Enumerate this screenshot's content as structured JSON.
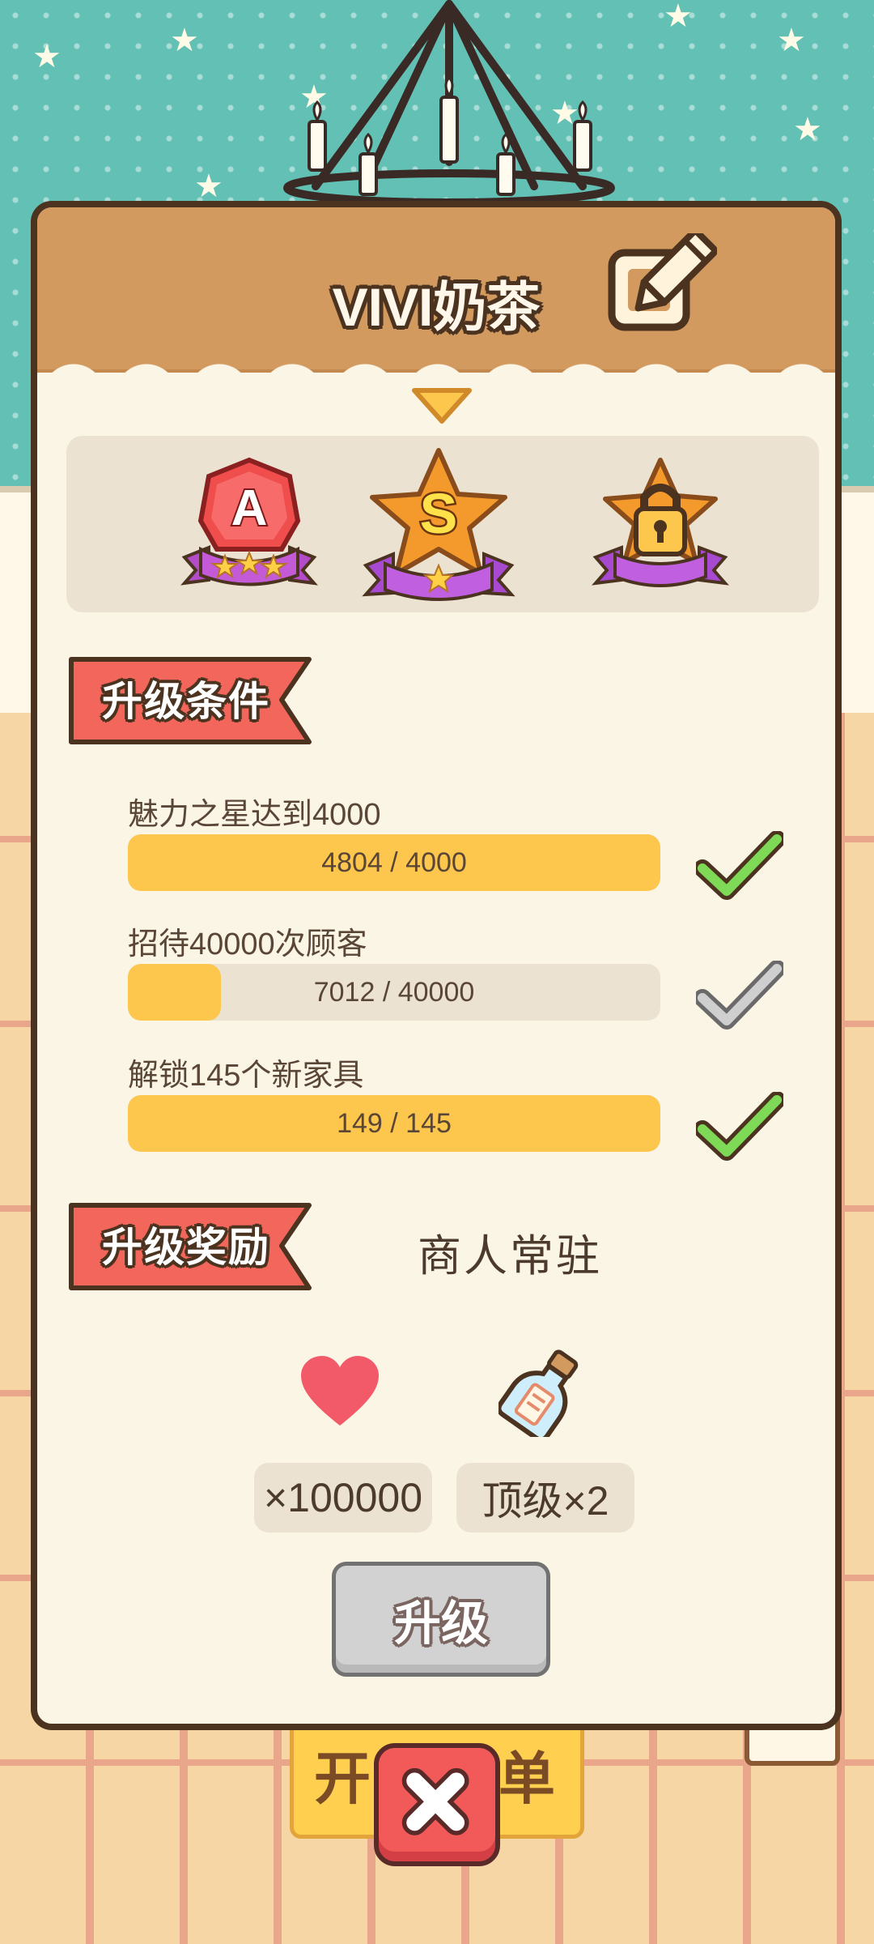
{
  "dialog": {
    "title": "VIVI奶茶",
    "edit_icon": "edit-pencil-icon"
  },
  "ranks": [
    {
      "letter": "A",
      "state": "completed",
      "stars": 3
    },
    {
      "letter": "S",
      "state": "current",
      "stars": 1
    },
    {
      "letter": "",
      "state": "locked",
      "icon": "lock-icon"
    }
  ],
  "conditions": {
    "header": "升级条件",
    "items": [
      {
        "label": "魅力之星达到4000",
        "progress_text": "4804 / 4000",
        "progress": 1.0,
        "met": true
      },
      {
        "label": "招待40000次顾客",
        "progress_text": "7012 / 40000",
        "progress": 0.1753,
        "met": false
      },
      {
        "label": "解锁145个新家具",
        "progress_text": "149 / 145",
        "progress": 1.0,
        "met": true
      }
    ]
  },
  "rewards": {
    "header": "升级奖励",
    "title": "商人常驻",
    "items": [
      {
        "icon": "heart-icon",
        "amount": "×100000"
      },
      {
        "icon": "message-bottle-icon",
        "amount": "顶级×2"
      }
    ]
  },
  "upgrade_button": "升级",
  "background_button": "开始接单",
  "close_icon": "close-icon",
  "colors": {
    "bar_fill": "#fdc64d",
    "check_met": "#7ed957",
    "check_unmet": "#cfcfcf",
    "ribbon": "#f2665c",
    "close": "#f25a5a"
  }
}
